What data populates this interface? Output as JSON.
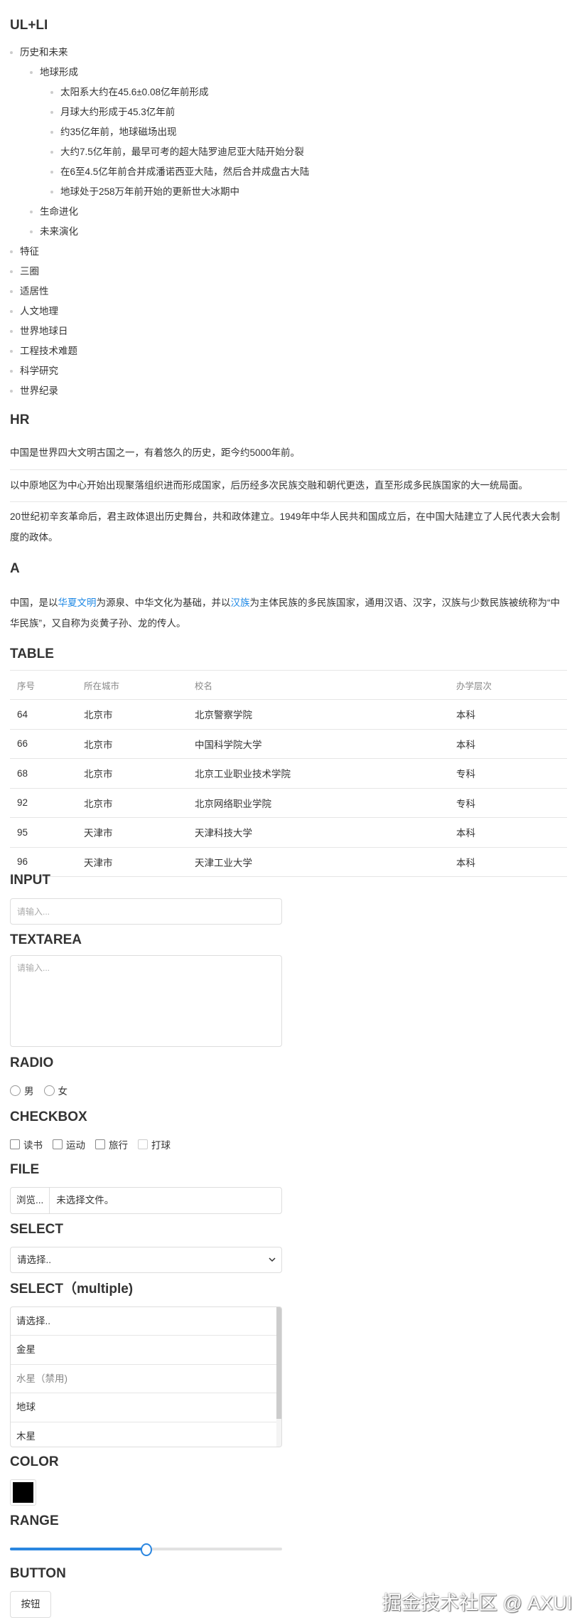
{
  "sections": {
    "ul": "UL+LI",
    "hr": "HR",
    "a": "A",
    "table": "TABLE",
    "input": "INPUT",
    "textarea": "TEXTAREA",
    "radio": "RADIO",
    "checkbox": "CHECKBOX",
    "file": "FILE",
    "select": "SELECT",
    "select_multiple": "SELECT（multiple)",
    "color": "COLOR",
    "range": "RANGE",
    "button": "BUTTON"
  },
  "list": [
    {
      "level": 1,
      "text": "历史和未来"
    },
    {
      "level": 2,
      "text": "地球形成"
    },
    {
      "level": 3,
      "text": "太阳系大约在45.6±0.08亿年前形成"
    },
    {
      "level": 3,
      "text": "月球大约形成于45.3亿年前"
    },
    {
      "level": 3,
      "text": "约35亿年前，地球磁场出现"
    },
    {
      "level": 3,
      "text": "大约7.5亿年前，最早可考的超大陆罗迪尼亚大陆开始分裂"
    },
    {
      "level": 3,
      "text": "在6至4.5亿年前合并成潘诺西亚大陆，然后合并成盘古大陆"
    },
    {
      "level": 3,
      "text": "地球处于258万年前开始的更新世大冰期中"
    },
    {
      "level": 2,
      "text": "生命进化"
    },
    {
      "level": 2,
      "text": "未来演化"
    },
    {
      "level": 1,
      "text": "特征"
    },
    {
      "level": 1,
      "text": "三圈"
    },
    {
      "level": 1,
      "text": "适居性"
    },
    {
      "level": 1,
      "text": "人文地理"
    },
    {
      "level": 1,
      "text": "世界地球日"
    },
    {
      "level": 1,
      "text": "工程技术难题"
    },
    {
      "level": 1,
      "text": "科学研究"
    },
    {
      "level": 1,
      "text": "世界纪录"
    }
  ],
  "hr_paragraphs": [
    "中国是世界四大文明古国之一，有着悠久的历史，距今约5000年前。",
    "以中原地区为中心开始出现聚落组织进而形成国家，后历经多次民族交融和朝代更迭，直至形成多民族国家的大一统局面。",
    "20世纪初辛亥革命后，君主政体退出历史舞台，共和政体建立。1949年中华人民共和国成立后，在中国大陆建立了人民代表大会制度的政体。"
  ],
  "a_paragraph": {
    "t1": "中国，是以",
    "link1": "华夏文明",
    "t2": "为源泉、中华文化为基础，并以",
    "link2": "汉族",
    "t3": "为主体民族的多民族国家，通用汉语、汉字，汉族与少数民族被统称为“中华民族”，又自称为炎黄子孙、龙的传人。"
  },
  "table": {
    "headers": [
      "序号",
      "所在城市",
      "校名",
      "办学层次"
    ],
    "rows": [
      [
        "64",
        "北京市",
        "北京警察学院",
        "本科"
      ],
      [
        "66",
        "北京市",
        "中国科学院大学",
        "本科"
      ],
      [
        "68",
        "北京市",
        "北京工业职业技术学院",
        "专科"
      ],
      [
        "92",
        "北京市",
        "北京网络职业学院",
        "专科"
      ],
      [
        "95",
        "天津市",
        "天津科技大学",
        "本科"
      ],
      [
        "96",
        "天津市",
        "天津工业大学",
        "本科"
      ]
    ]
  },
  "input": {
    "placeholder": "请输入..."
  },
  "textarea": {
    "placeholder": "请输入..."
  },
  "radio": [
    "男",
    "女"
  ],
  "checkbox": [
    "读书",
    "运动",
    "旅行",
    "打球"
  ],
  "file": {
    "button": "浏览...",
    "status": "未选择文件。"
  },
  "select": {
    "value": "请选择.."
  },
  "select_multiple": {
    "options": [
      "请选择..",
      "金星",
      "水星（禁用)",
      "地球",
      "木星"
    ],
    "disabled_index": 2
  },
  "color": {
    "value": "#000000"
  },
  "range": {
    "value": 50,
    "min": 0,
    "max": 100,
    "accent": "#2a86e0"
  },
  "button": {
    "label": "按钮"
  },
  "watermark": "掘金技术社区 @ AXUI"
}
